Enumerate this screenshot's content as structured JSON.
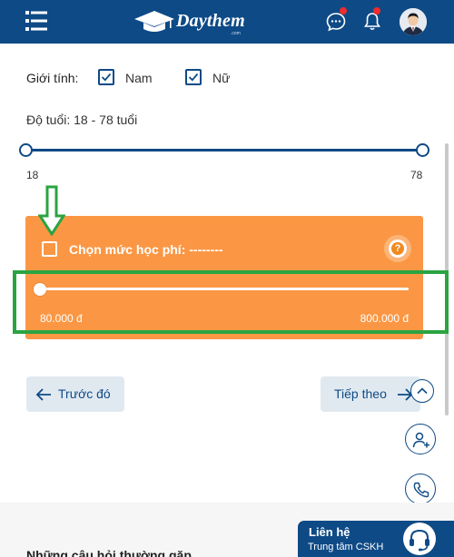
{
  "header": {
    "logo_text": "Daythem",
    "logo_sub": ".com",
    "icons": [
      "menu-icon",
      "chat-icon",
      "bell-icon",
      "avatar"
    ],
    "colors": {
      "primary": "#0e4a86",
      "notification": "#ef2b2b"
    }
  },
  "filters": {
    "gender_label": "Giới tính:",
    "gender_options": [
      {
        "label": "Nam",
        "checked": true
      },
      {
        "label": "Nữ",
        "checked": true
      }
    ],
    "age_label": "Độ tuổi: 18 - 78 tuổi",
    "age_range": {
      "min_label": "18",
      "max_label": "78",
      "selected_min": 18,
      "selected_max": 78
    }
  },
  "fee": {
    "checkbox_checked": false,
    "title": "Chọn mức học phí: --------",
    "help_icon": "?",
    "min_label": "80.000 đ",
    "max_label": "800.000 đ",
    "slider_fraction": 0,
    "color": "#fb9744"
  },
  "nav": {
    "prev_label": "Trước đó",
    "next_label": "Tiếp theo"
  },
  "floating": [
    "chevron-up-icon",
    "add-user-icon",
    "phone-icon"
  ],
  "footer": {
    "faq_label": "Những câu hỏi thường gặp",
    "contact_title": "Liên hệ",
    "contact_sub": "Trung tâm CSKH"
  },
  "annotation_color": "#2aa441"
}
